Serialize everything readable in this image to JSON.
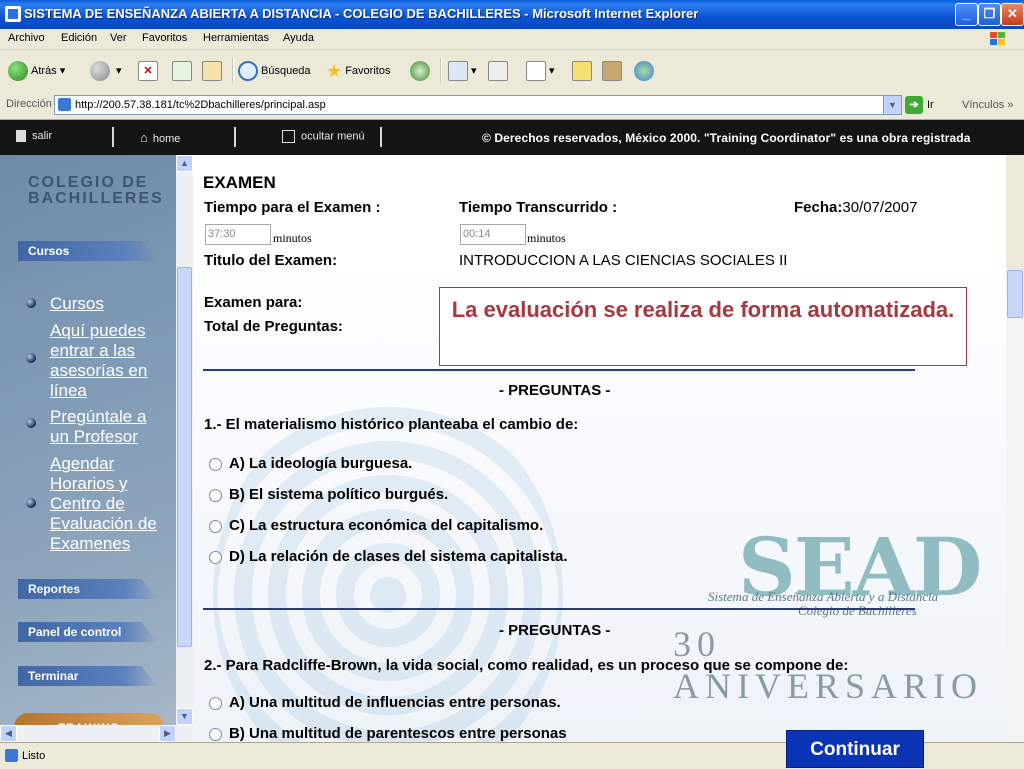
{
  "window": {
    "title": "SISTEMA DE ENSEÑANZA ABIERTA A DISTANCIA - COLEGIO DE BACHILLERES - Microsoft Internet Explorer"
  },
  "menu": [
    "Archivo",
    "Edición",
    "Ver",
    "Favoritos",
    "Herramientas",
    "Ayuda"
  ],
  "toolbar": {
    "back": "Atrás",
    "search": "Búsqueda",
    "favorites": "Favoritos"
  },
  "address": {
    "label": "Dirección",
    "url": "http://200.57.38.181/tc%2Dbachilleres/principal.asp",
    "go": "Ir",
    "links": "Vínculos"
  },
  "app_header": {
    "exit": "salir",
    "home": "home",
    "hide_menu": "ocultar menú",
    "copyright": "© Derechos reservados, México 2000. \"Training Coordinator\" es una obra registrada"
  },
  "sidebar": {
    "logo_line1": "COLEGIO DE",
    "logo_line2": "BACHILLERES",
    "section_cursos": "Cursos",
    "links": [
      "Cursos",
      "Aquí puedes entrar a las asesorías en línea",
      "Pregúntale a un Profesor",
      "Agendar Horarios y Centro de Evaluación de Examenes"
    ],
    "section_reportes": "Reportes",
    "section_panel": "Panel de control",
    "section_terminar": "Terminar",
    "training": "TRAINING"
  },
  "exam": {
    "heading": "EXAMEN",
    "time_label": "Tiempo para el Examen :",
    "time_value": "37:30",
    "time_unit": "minutos",
    "elapsed_label": "Tiempo Transcurrido :",
    "elapsed_value": "00:14",
    "elapsed_unit": "minutos",
    "date_label": "Fecha:",
    "date_value": "30/07/2007",
    "title_label": "Titulo del Examen:",
    "title_value": "INTRODUCCION A LAS CIENCIAS SOCIALES II",
    "for_label": "Examen para:",
    "total_label": "Total de Preguntas:",
    "notice": "La evaluación se realiza de forma automatizada.",
    "questions_header": "- PREGUNTAS -",
    "q1": "1.- El materialismo histórico planteaba el cambio de:",
    "q1_options": [
      "A) La ideología burguesa.",
      "B) El sistema político burgués.",
      "C) La estructura económica del capitalismo.",
      "D) La relación de clases del sistema capitalista."
    ],
    "q2": "2.- Para Radcliffe-Brown, la vida social, como realidad, es un proceso que se compone de:",
    "q2_options": [
      "A) Una multitud de influencias entre personas.",
      "B) Una multitud de parentescos entre personas"
    ]
  },
  "watermark": {
    "sead": "SEAD",
    "line1": "Sistema de Enseñanza Abierta y a Distancia",
    "line2": "Colegio de Bachilleres",
    "aniversario": "30 ANIVERSARIO"
  },
  "status": "Listo",
  "continue_button": "Continuar"
}
